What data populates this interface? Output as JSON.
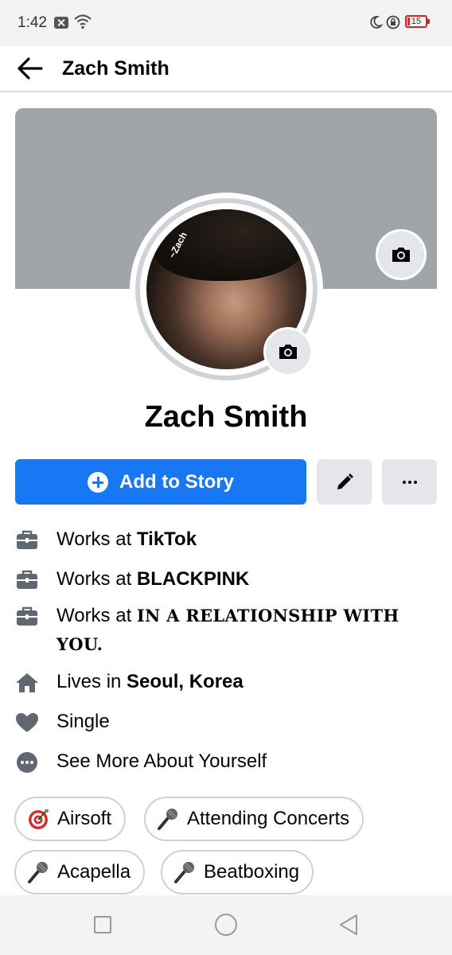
{
  "status_bar": {
    "time": "1:42",
    "battery": "15"
  },
  "header": {
    "title": "Zach Smith"
  },
  "profile": {
    "name": "Zach Smith",
    "avatar_signature": "~Zach"
  },
  "actions": {
    "add_story_label": "Add to Story"
  },
  "details": [
    {
      "icon": "briefcase-icon",
      "prefix": "Works at ",
      "value": "TikTok"
    },
    {
      "icon": "briefcase-icon",
      "prefix": "Works at ",
      "value": "BLACKPINK"
    },
    {
      "icon": "briefcase-icon",
      "prefix": "Works at ",
      "value": "IN A RELATIONSHIP WITH",
      "value_line2": "YOU."
    },
    {
      "icon": "home-icon",
      "prefix": "Lives in ",
      "value": "Seoul, Korea"
    },
    {
      "icon": "heart-icon",
      "text": "Single"
    },
    {
      "icon": "more-circle-icon",
      "text": "See More About Yourself"
    }
  ],
  "hobbies": [
    {
      "icon": "target-icon",
      "label": "Airsoft"
    },
    {
      "icon": "microphone-icon",
      "label": "Attending Concerts"
    },
    {
      "icon": "microphone-icon",
      "label": "Acapella"
    },
    {
      "icon": "microphone-icon",
      "label": "Beatboxing"
    }
  ],
  "colors": {
    "primary": "#1877f2",
    "cover": "#a1a4a9",
    "secondary_button": "#e4e6eb"
  }
}
